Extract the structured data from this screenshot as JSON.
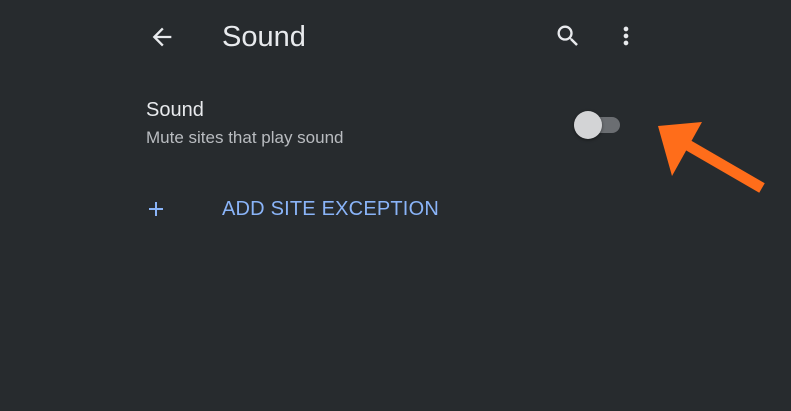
{
  "toolbar": {
    "title": "Sound",
    "back_icon": "arrow-back-icon",
    "search_icon": "search-icon",
    "more_icon": "more-vert-icon"
  },
  "setting": {
    "title": "Sound",
    "description": "Mute sites that play sound",
    "toggle_enabled": false
  },
  "add_exception": {
    "icon": "plus-icon",
    "label": "ADD SITE EXCEPTION"
  },
  "colors": {
    "background": "#272b2e",
    "text_primary": "#e8eaed",
    "text_secondary": "#b9bcc0",
    "accent_blue": "#8ab4f8",
    "annotation_arrow": "#ff6d1a"
  }
}
